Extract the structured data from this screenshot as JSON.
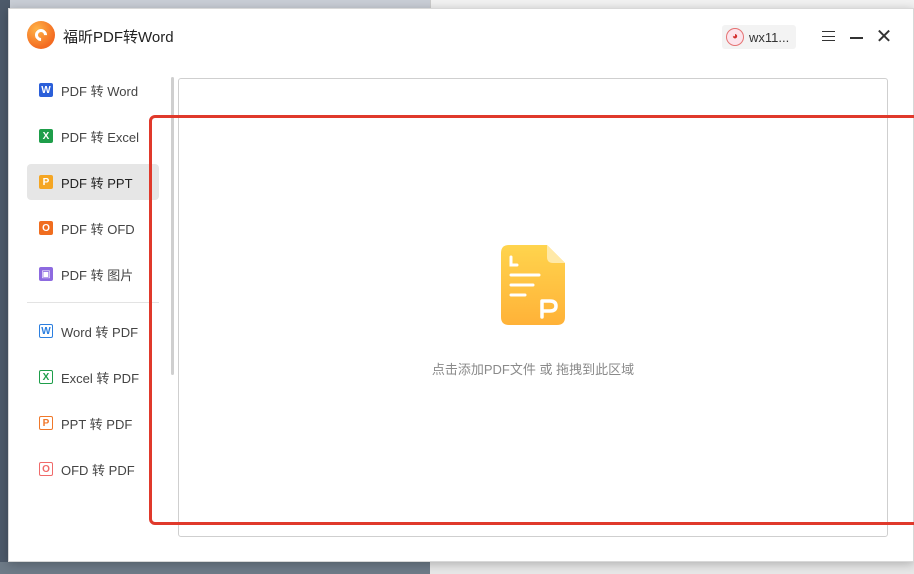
{
  "app": {
    "title": "福昕PDF转Word",
    "logo_icon": "foxit-logo-icon",
    "brand_color": "#f36b21"
  },
  "user": {
    "avatar_glyph": "ʕ•ᴥ•ʔ",
    "name": "wx11..."
  },
  "window_controls": {
    "menu_icon": "hamburger-icon",
    "minimize_icon": "minimize-icon",
    "close_icon": "close-icon",
    "close_glyph": "✕"
  },
  "sidebar": {
    "items": [
      {
        "label": "PDF 转 Word",
        "icon": "word-icon",
        "glyph": "W",
        "color": "#2b5fd9",
        "active": false
      },
      {
        "label": "PDF 转 Excel",
        "icon": "excel-icon",
        "glyph": "X",
        "color": "#1e9e4a",
        "active": false
      },
      {
        "label": "PDF 转 PPT",
        "icon": "ppt-icon",
        "glyph": "P",
        "color": "#f5a623",
        "active": true
      },
      {
        "label": "PDF 转 OFD",
        "icon": "ofd-icon",
        "glyph": "O",
        "color": "#f06d1f",
        "active": false
      },
      {
        "label": "PDF 转 图片",
        "icon": "image-icon",
        "glyph": "▣",
        "color": "#8d6ae0",
        "active": false
      }
    ],
    "items2": [
      {
        "label": "Word 转 PDF",
        "icon": "word-to-pdf-icon",
        "glyph": "W",
        "color": "#2b7fe0"
      },
      {
        "label": "Excel 转 PDF",
        "icon": "excel-to-pdf-icon",
        "glyph": "X",
        "color": "#1e9e4a"
      },
      {
        "label": "PPT 转 PDF",
        "icon": "ppt-to-pdf-icon",
        "glyph": "P",
        "color": "#f0782a"
      },
      {
        "label": "OFD 转 PDF",
        "icon": "ofd-to-pdf-icon",
        "glyph": "O",
        "color": "#f06a6a"
      }
    ]
  },
  "dropzone": {
    "hint": "点击添加PDF文件 或 拖拽到此区域",
    "file_icon": "ppt-file-icon",
    "file_letter": "P",
    "highlight_color": "#e0392b"
  }
}
